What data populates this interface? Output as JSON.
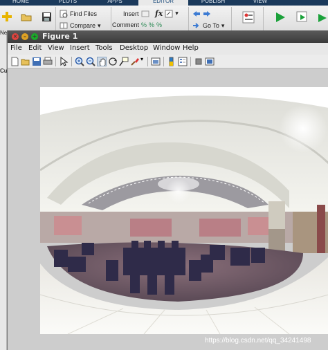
{
  "toolstrip_tabs": [
    {
      "label": "HOME",
      "active": false
    },
    {
      "label": "PLOTS",
      "active": false
    },
    {
      "label": "APPS",
      "active": false
    },
    {
      "label": "EDITOR",
      "active": true
    },
    {
      "label": "PUBLISH",
      "active": false
    },
    {
      "label": "VIEW",
      "active": false
    }
  ],
  "toolstrip": {
    "find_files": "Find Files",
    "compare": "Compare",
    "insert": "Insert",
    "fx": "fx",
    "comment": "Comment",
    "goto": "Go To",
    "new_partial": "Ne",
    "cu_partial": "Cu"
  },
  "figure_window": {
    "title": "Figure 1",
    "menu": [
      "File",
      "Edit",
      "View",
      "Insert",
      "Tools",
      "Desktop",
      "Window",
      "Help"
    ],
    "toolbar_icons": [
      "new-figure-icon",
      "open-file-icon",
      "save-figure-icon",
      "print-figure-icon",
      "edit-plot-icon",
      "zoom-in-icon",
      "zoom-out-icon",
      "pan-icon",
      "rotate-3d-icon",
      "data-cursor-icon",
      "brush-icon",
      "link-plot-icon",
      "insert-colorbar-icon",
      "insert-legend-icon",
      "hide-plot-tools-icon",
      "show-plot-tools-icon"
    ],
    "active_tool": "pan-icon"
  },
  "colors": {
    "tab_bar": "#1b3a5c",
    "active_tab_text": "#1f4f7f",
    "title_bar": "#3b3b3b",
    "close_button": "#e0443e",
    "minimize_button": "#dea123",
    "maximize_button": "#1aab29",
    "canvas_bg": "#cdcdcd"
  },
  "watermark": "https://blog.csdn.net/qq_34241498"
}
